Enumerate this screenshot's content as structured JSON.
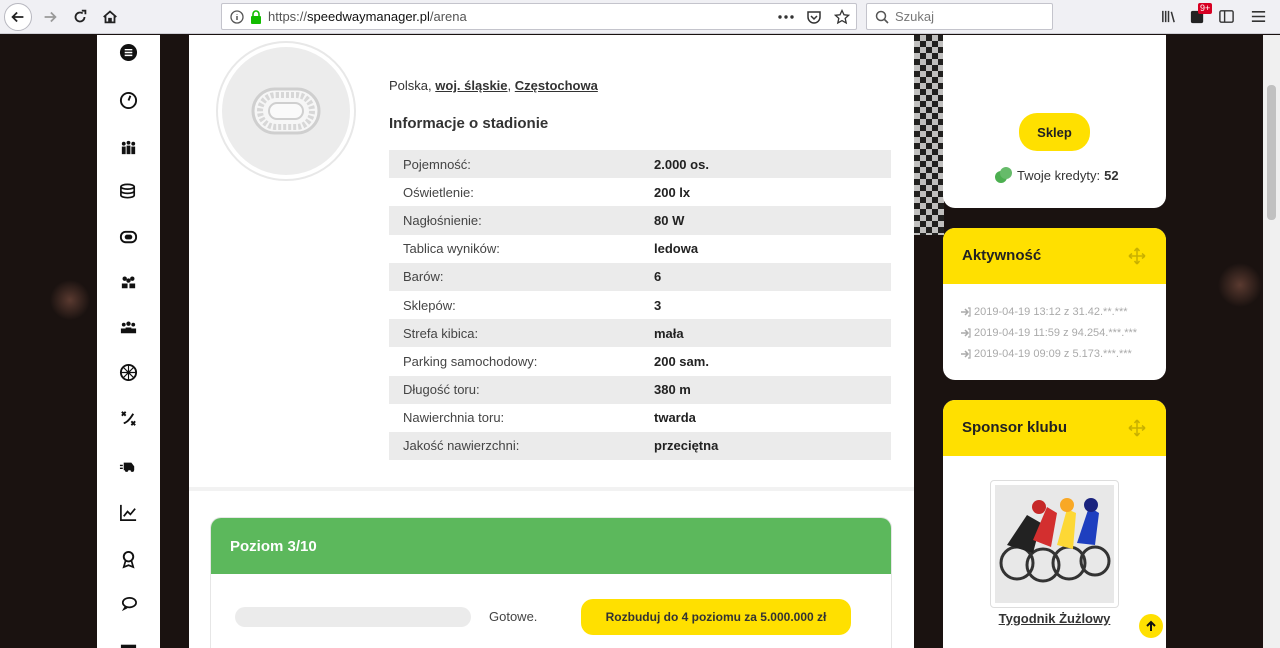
{
  "browser": {
    "url_prefix": "https://",
    "url_domain": "speedwaymanager.pl",
    "url_path": "/arena",
    "search_placeholder": "Szukaj",
    "notif_badge": "9+"
  },
  "location": {
    "country": "Polska",
    "region": "woj. śląskie",
    "city": "Częstochowa"
  },
  "info": {
    "title": "Informacje o stadionie",
    "rows": [
      {
        "key": "Pojemność:",
        "value": "2.000 os."
      },
      {
        "key": "Oświetlenie:",
        "value": "200 lx"
      },
      {
        "key": "Nagłośnienie:",
        "value": "80 W"
      },
      {
        "key": "Tablica wyników:",
        "value": "ledowa"
      },
      {
        "key": "Barów:",
        "value": "6"
      },
      {
        "key": "Sklepów:",
        "value": "3"
      },
      {
        "key": "Strefa kibica:",
        "value": "mała"
      },
      {
        "key": "Parking samochodowy:",
        "value": "200 sam."
      },
      {
        "key": "Długość toru:",
        "value": "380 m"
      },
      {
        "key": "Nawierchnia toru:",
        "value": "twarda"
      },
      {
        "key": "Jakość nawierzchni:",
        "value": "przeciętna"
      }
    ]
  },
  "level": {
    "title": "Poziom 3/10",
    "progress": 0,
    "status": "Gotowe.",
    "upgrade_label": "Rozbuduj do 4 poziomu za 5.000.000 zł"
  },
  "shop": {
    "button_label": "Sklep",
    "credits_label": "Twoje kredyty:",
    "credits_value": "52"
  },
  "activity": {
    "title": "Aktywność",
    "entries": [
      "2019-04-19 13:12 z 31.42.**.***",
      "2019-04-19 11:59 z 94.254.***.***",
      "2019-04-19 09:09 z 5.173.***.***"
    ]
  },
  "sponsor": {
    "title": "Sponsor klubu",
    "name": "Tygodnik Żużlowy"
  },
  "colors": {
    "accent_yellow": "#ffe000",
    "level_green": "#5cb85c"
  }
}
